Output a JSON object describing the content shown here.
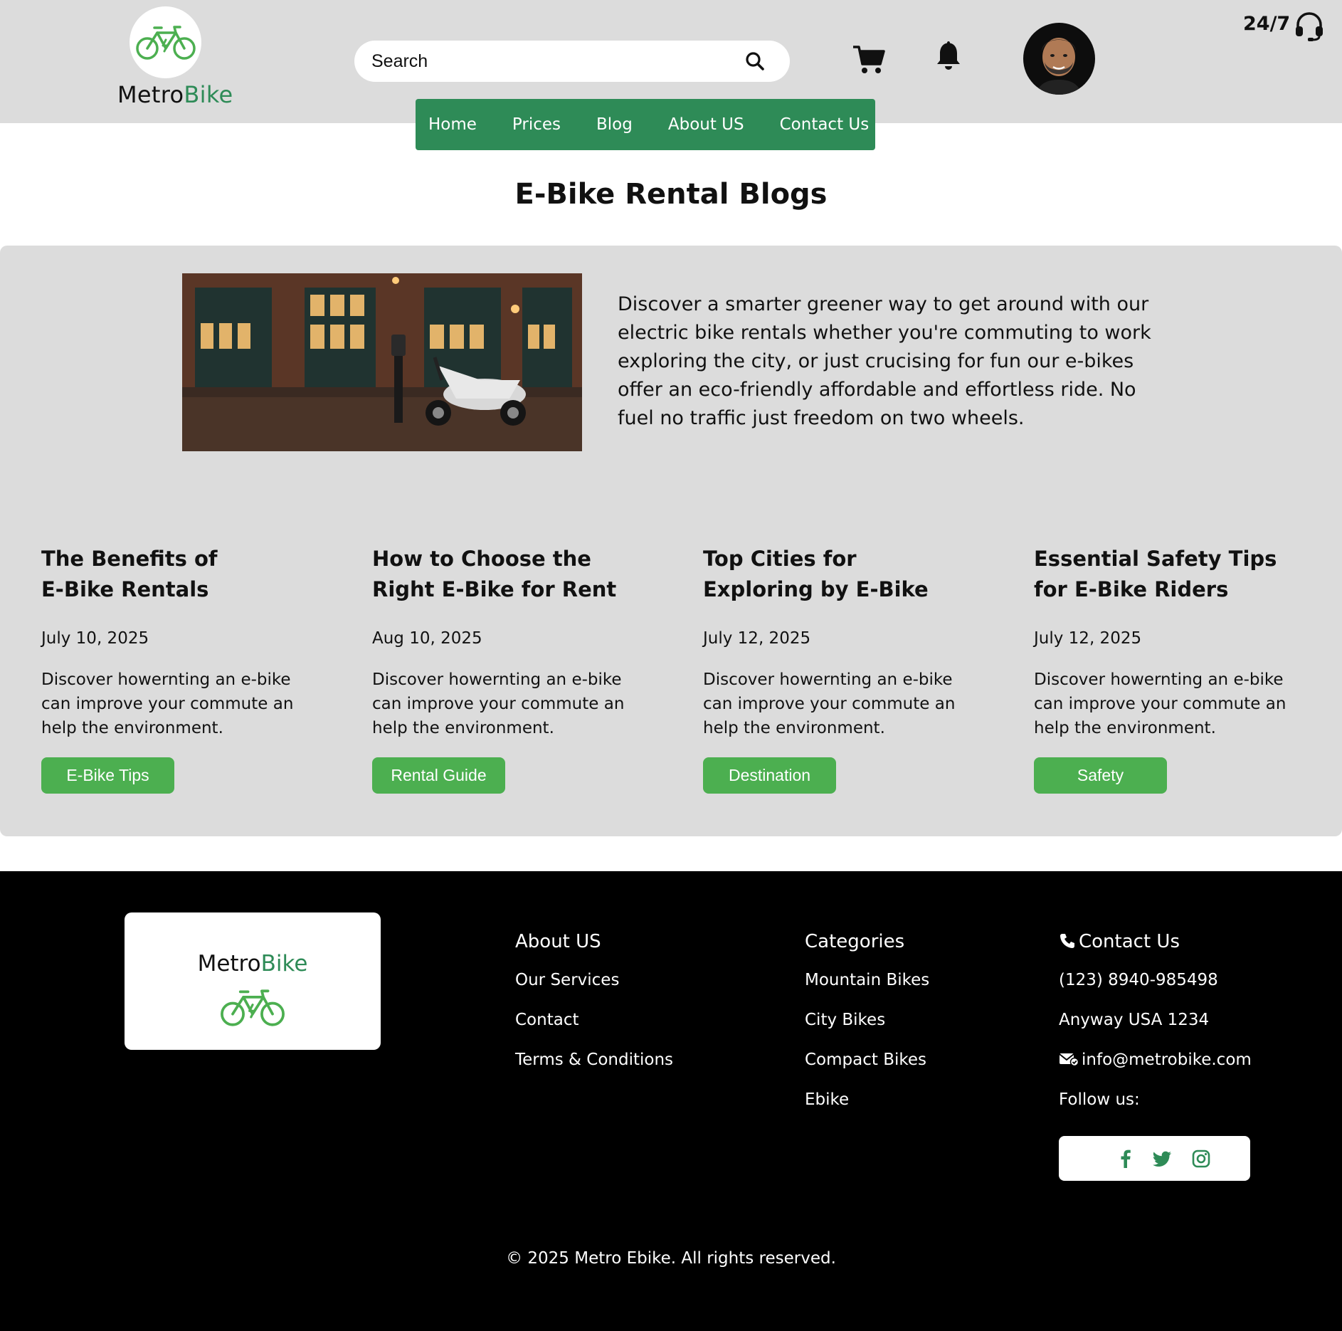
{
  "header": {
    "brand_part1": "Metro",
    "brand_part2": "Bike",
    "search_placeholder": "Search",
    "support_text": "24/7",
    "icons": [
      "bike-icon",
      "search-icon",
      "cart-icon",
      "bell-icon",
      "headset-icon"
    ]
  },
  "nav": {
    "items": [
      "Home",
      "Prices",
      "Blog",
      "About US",
      "Contact Us"
    ]
  },
  "page": {
    "title": "E-Bike Rental Blogs"
  },
  "hero": {
    "text": "Discover a smarter greener way to get around with our electric bike rentals whether you're commuting to work exploring the city, or just crucising for fun our e-bikes offer an eco-friendly affordable and effortless ride. No fuel no traffic just freedom on two wheels."
  },
  "cards": [
    {
      "title_line1": "The Benefits of",
      "title_line2": "E-Bike Rentals",
      "date": "July 10, 2025",
      "desc": "Discover howernting an e-bike can improve your commute an help the environment.",
      "tag": "E-Bike Tips"
    },
    {
      "title_line1": "How to Choose the",
      "title_line2": "Right E-Bike for Rent",
      "date": "Aug 10, 2025",
      "desc": "Discover howernting an e-bike can improve your commute an help the environment.",
      "tag": "Rental Guide"
    },
    {
      "title_line1": "Top Cities for",
      "title_line2": "Exploring by E-Bike",
      "date": "July 12, 2025",
      "desc": "Discover howernting an e-bike can improve your commute an help the environment.",
      "tag": "Destination"
    },
    {
      "title_line1": "Essential Safety Tips",
      "title_line2": "for E-Bike Riders",
      "date": "July 12, 2025",
      "desc": "Discover howernting an e-bike can improve your commute an help the environment.",
      "tag": "Safety"
    }
  ],
  "footer": {
    "brand_part1": "Metro",
    "brand_part2": "Bike",
    "about": {
      "heading": "About US",
      "items": [
        "Our Services",
        "Contact",
        "Terms & Conditions"
      ]
    },
    "categories": {
      "heading": "Categories",
      "items": [
        "Mountain Bikes",
        "City Bikes",
        "Compact Bikes",
        "Ebike"
      ]
    },
    "contact": {
      "heading": "Contact Us",
      "phone": "(123) 8940-985498",
      "address": "Anyway USA 1234",
      "email": "info@metrobike.com",
      "follow": "Follow us:"
    },
    "social_icons": [
      "facebook-icon",
      "twitter-icon",
      "instagram-icon"
    ],
    "copyright": "© 2025 Metro Ebike. All rights reserved."
  },
  "colors": {
    "brand_green": "#2e8b57",
    "tag_green": "#4caf50",
    "header_bg": "#dcdcdc",
    "footer_bg": "#000000"
  }
}
